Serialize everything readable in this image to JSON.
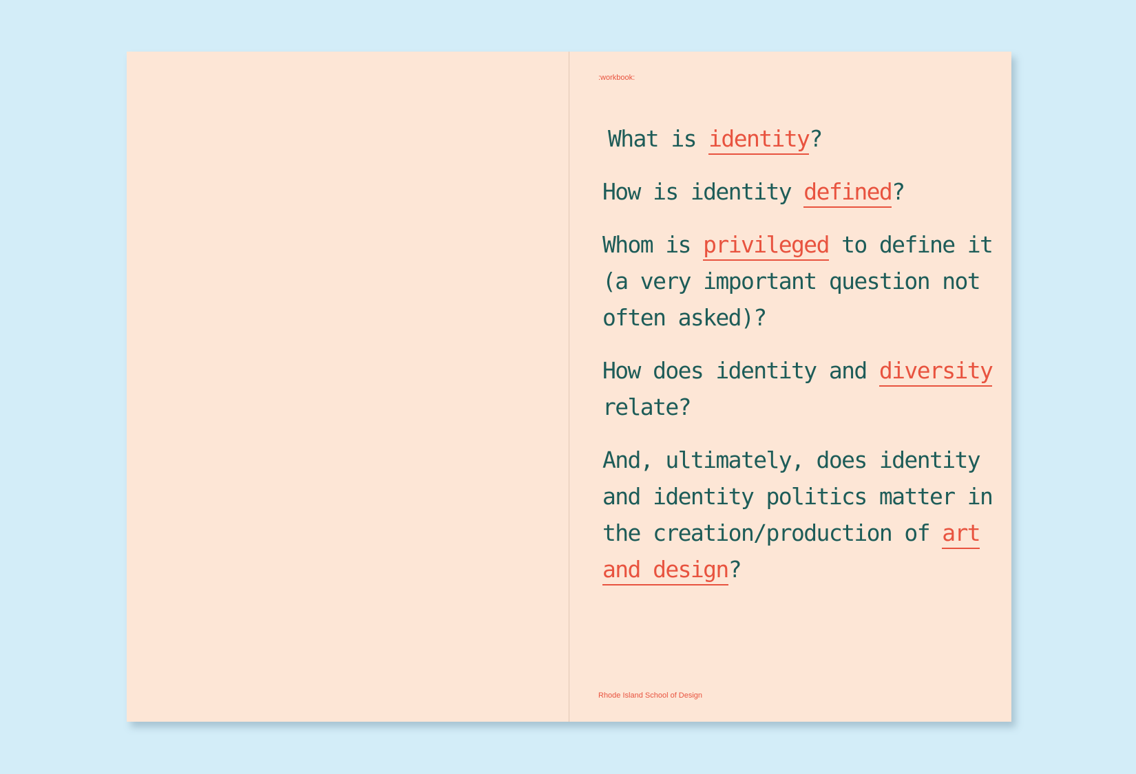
{
  "running_head": ":workbook:",
  "footer": "Rhode Island School of Design",
  "questions": [
    {
      "a": "What is ",
      "b": "identity",
      "c": "?"
    },
    {
      "a": "How is identity ",
      "b": "defined",
      "c": "?"
    },
    {
      "a": "Whom is ",
      "b": "privileged",
      "c": " to define it (a very important question not often asked)?"
    },
    {
      "a": "How does identity and ",
      "b": "diversity",
      "c": " relate?"
    },
    {
      "a": "And, ultimately, does identity and identity politics matter in the creation/production of ",
      "b": "art and design",
      "c": "?"
    }
  ],
  "colors": {
    "background": "#d3edf8",
    "paper": "#fde6d6",
    "text": "#1d5c58",
    "accent": "#e8533f"
  }
}
